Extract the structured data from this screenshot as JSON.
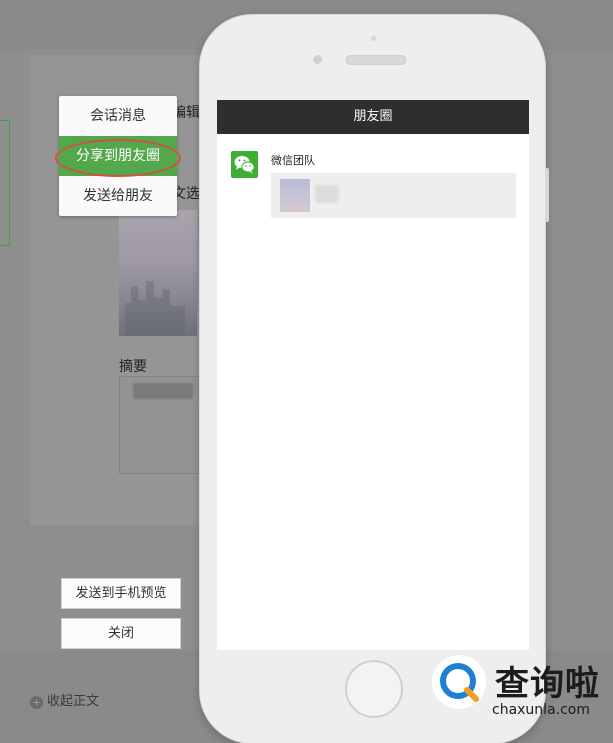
{
  "editor": {
    "edit_label": "编辑",
    "select_label": "文选",
    "summary_label": "摘要"
  },
  "share_menu": {
    "items": [
      {
        "label": "会话消息"
      },
      {
        "label": "分享到朋友圈",
        "selected": true
      },
      {
        "label": "发送给朋友"
      }
    ]
  },
  "buttons": {
    "send_preview": "发送到手机预览",
    "close": "关闭"
  },
  "collapse": {
    "label": "收起正文",
    "icon": "plus-circle-icon"
  },
  "phone": {
    "title": "朋友圈",
    "post": {
      "author": "微信团队",
      "avatar_icon": "wechat-logo-icon"
    }
  },
  "watermark": {
    "name": "查询啦",
    "url": "chaxunla.com",
    "icon": "magnifier-q-icon"
  },
  "colors": {
    "wechat_green": "#3cb034",
    "menu_selected": "#53a84c",
    "highlight_ring": "#d4503e",
    "title_bar": "#2e2e2e",
    "watermark_accent": "#f0a020",
    "watermark_blue": "#1f7fd6"
  }
}
